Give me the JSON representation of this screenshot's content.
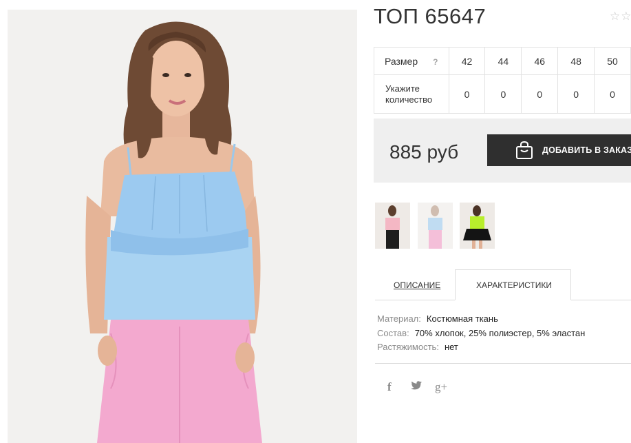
{
  "product": {
    "title": "ТОП 65647",
    "rating_stars": "☆☆☆"
  },
  "sizes": {
    "size_label": "Размер",
    "hint": "?",
    "qty_label": "Укажите количество",
    "values": [
      "42",
      "44",
      "46",
      "48",
      "50"
    ],
    "quantities": [
      "0",
      "0",
      "0",
      "0",
      "0"
    ]
  },
  "price": {
    "amount": "885 руб",
    "add_button_label": "ДОБАВИТЬ В ЗАКАЗ"
  },
  "thumbnails": [
    {
      "top_color": "#f4b7c4",
      "bottom_color": "#1e1e1e"
    },
    {
      "top_color": "#a9d3f2",
      "bottom_color": "#f3a9cf"
    },
    {
      "top_color": "#b8ee2c",
      "bottom_color": "#141414"
    }
  ],
  "tabs": {
    "description": "ОПИСАНИЕ",
    "characteristics": "ХАРАКТЕРИСТИКИ"
  },
  "specs": [
    {
      "key": "Материал:",
      "value": "Костюмная ткань"
    },
    {
      "key": "Состав:",
      "value": "70% хлопок, 25% полиэстер, 5% эластан"
    },
    {
      "key": "Растяжимость:",
      "value": "нет"
    }
  ],
  "social": {
    "facebook": "f",
    "twitter": "🐦",
    "googleplus": "g+"
  },
  "colors": {
    "top_blue": "#a9d3f2",
    "pants_pink": "#f3a9cf",
    "button_dark": "#2f2f2f",
    "price_bg": "#efefef"
  }
}
